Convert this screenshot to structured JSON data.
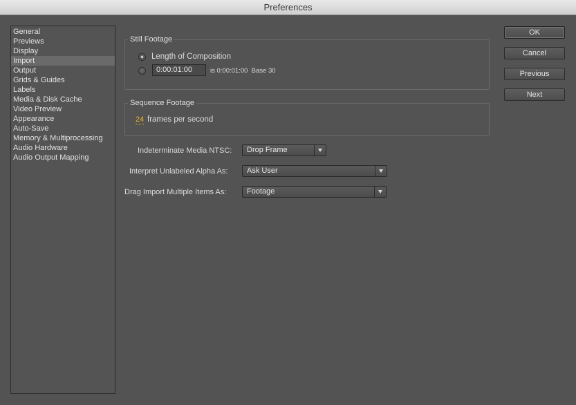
{
  "window": {
    "title": "Preferences"
  },
  "sidebar": {
    "selected_index": 3,
    "items": [
      {
        "label": "General"
      },
      {
        "label": "Previews"
      },
      {
        "label": "Display"
      },
      {
        "label": "Import"
      },
      {
        "label": "Output"
      },
      {
        "label": "Grids & Guides"
      },
      {
        "label": "Labels"
      },
      {
        "label": "Media & Disk Cache"
      },
      {
        "label": "Video Preview"
      },
      {
        "label": "Appearance"
      },
      {
        "label": "Auto-Save"
      },
      {
        "label": "Memory & Multiprocessing"
      },
      {
        "label": "Audio Hardware"
      },
      {
        "label": "Audio Output Mapping"
      }
    ]
  },
  "still_footage": {
    "title": "Still Footage",
    "length_of_composition_label": "Length of Composition",
    "length_of_composition_checked": true,
    "custom_checked": false,
    "timecode_value": "0:00:01:00",
    "timecode_note": "is 0:00:01:00  Base 30"
  },
  "sequence_footage": {
    "title": "Sequence Footage",
    "frames_value": "24",
    "frames_label": "frames per second"
  },
  "options": {
    "ntsc": {
      "label": "Indeterminate Media NTSC:",
      "value": "Drop Frame"
    },
    "alpha": {
      "label": "Interpret Unlabeled Alpha As:",
      "value": "Ask User"
    },
    "drag_import": {
      "label": "Drag Import Multiple Items As:",
      "value": "Footage"
    }
  },
  "buttons": {
    "ok": "OK",
    "cancel": "Cancel",
    "previous": "Previous",
    "next": "Next"
  },
  "colors": {
    "background": "#535353",
    "accent_number": "#e8b32c"
  }
}
